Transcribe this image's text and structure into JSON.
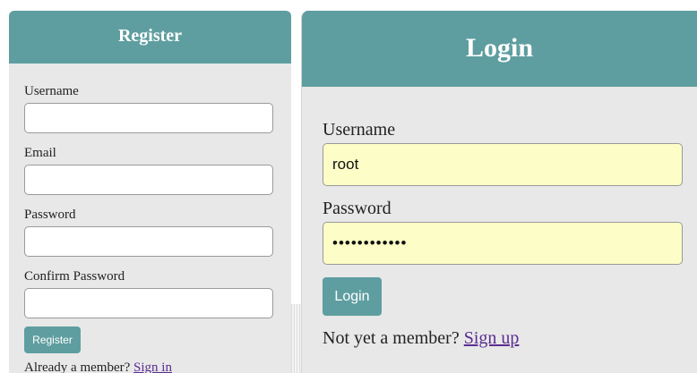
{
  "register": {
    "title": "Register",
    "fields": [
      {
        "label": "Username",
        "value": "",
        "type": "text"
      },
      {
        "label": "Email",
        "value": "",
        "type": "text"
      },
      {
        "label": "Password",
        "value": "",
        "type": "password"
      },
      {
        "label": "Confirm Password",
        "value": "",
        "type": "password"
      }
    ],
    "button_label": "Register",
    "footer_text": "Already a member? ",
    "footer_link": "Sign in"
  },
  "login": {
    "title": "Login",
    "username_label": "Username",
    "username_value": "root",
    "password_label": "Password",
    "password_value": "••••••••••••",
    "button_label": "Login",
    "footer_text": "Not yet a member? ",
    "footer_link": "Sign up"
  },
  "colors": {
    "accent": "#5f9ea0",
    "panel_bg": "#e8e8e8",
    "autofill_bg": "#fdfdc7",
    "link": "#5a2d91"
  }
}
